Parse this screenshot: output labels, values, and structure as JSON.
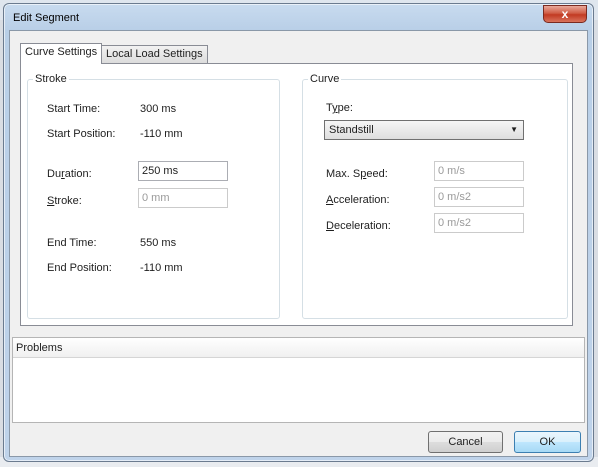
{
  "window": {
    "title": "Edit Segment",
    "close_glyph": "x"
  },
  "tabs": [
    {
      "label": "Curve Settings",
      "active": true
    },
    {
      "label": "Local Load Settings",
      "active": false
    }
  ],
  "stroke": {
    "group_label": "Stroke",
    "start_time_label": "Start Time:",
    "start_time_value": "300 ms",
    "start_position_label": "Start Position:",
    "start_position_value": "-110 mm",
    "duration_label": "Duration:",
    "duration_value": "250 ms",
    "stroke_label": "Stroke:",
    "stroke_value": "0 mm",
    "end_time_label": "End Time:",
    "end_time_value": "550 ms",
    "end_position_label": "End Position:",
    "end_position_value": "-110 mm"
  },
  "curve": {
    "group_label": "Curve",
    "type_label": "Type:",
    "type_value": "Standstill",
    "max_speed_label": "Max. Speed:",
    "max_speed_value": "0 m/s",
    "acceleration_label": "Acceleration:",
    "acceleration_value": "0 m/s2",
    "deceleration_label": "Deceleration:",
    "deceleration_value": "0 m/s2"
  },
  "problems": {
    "header": "Problems"
  },
  "buttons": {
    "cancel": "Cancel",
    "ok": "OK"
  }
}
